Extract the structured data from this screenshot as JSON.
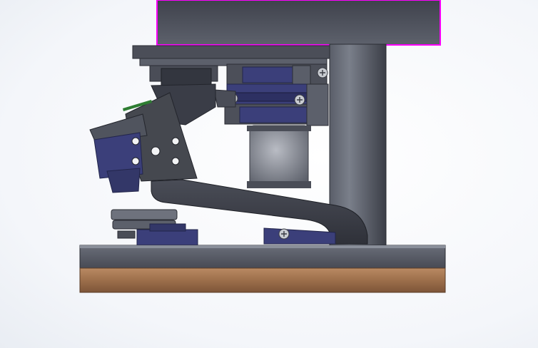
{
  "view": {
    "kind": "cad-model-viewport"
  },
  "colors": {
    "background": "#f4f6fa",
    "selection_outline": "#ff00ff",
    "metal_dark": "#3a3d47",
    "metal_mid": "#5b5f6b",
    "metal_light": "#8a8f9a",
    "bracket_navy": "#3b3f7a",
    "wood_base": "#a87a55",
    "accent_green": "#2e7d32"
  },
  "icons": {
    "screw": "cross-head-screw-icon"
  }
}
